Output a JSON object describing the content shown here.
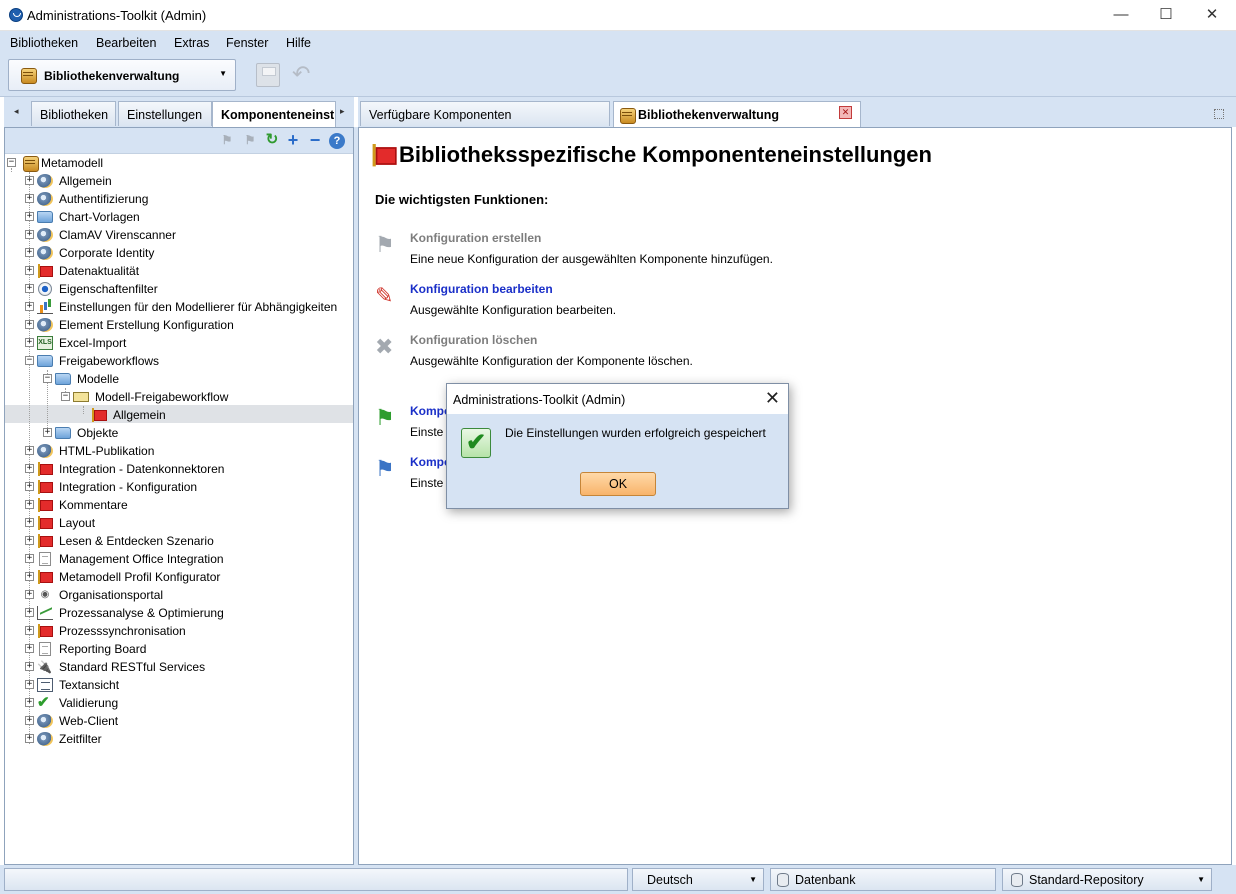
{
  "window": {
    "title": "Administrations-Toolkit (Admin)",
    "min": "—",
    "max": "☐",
    "close": "✕"
  },
  "menu": [
    "Bibliotheken",
    "Bearbeiten",
    "Extras",
    "Fenster",
    "Hilfe"
  ],
  "toolbar": {
    "library_select": "Bibliothekenverwaltung"
  },
  "left_tabs": [
    "Bibliotheken",
    "Einstellungen",
    "Komponenteneinst"
  ],
  "right_tabs": [
    "Verfügbare Komponenten",
    "Bibliothekenverwaltung"
  ],
  "tree": {
    "root": "Metamodell",
    "items": [
      "Allgemein",
      "Authentifizierung",
      "Chart-Vorlagen",
      "ClamAV Virenscanner",
      "Corporate Identity",
      "Datenaktualität",
      "Eigenschaftenfilter",
      "Einstellungen für den Modellierer für Abhängigkeiten",
      "Element Erstellung Konfiguration",
      "Excel-Import",
      "Freigabeworkflows"
    ],
    "freigabe_children": {
      "modelle": "Modelle",
      "modell_workflow": "Modell-Freigabeworkflow",
      "allgemein": "Allgemein",
      "objekte": "Objekte"
    },
    "items_after": [
      "HTML-Publikation",
      "Integration - Datenkonnektoren",
      "Integration - Konfiguration",
      "Kommentare",
      "Layout",
      "Lesen & Entdecken Szenario",
      "Management Office Integration",
      "Metamodell Profil Konfigurator",
      "Organisationsportal",
      "Prozessanalyse & Optimierung",
      "Prozesssynchronisation",
      "Reporting Board",
      "Standard RESTful Services",
      "Textansicht",
      "Validierung",
      "Web-Client",
      "Zeitfilter"
    ]
  },
  "content": {
    "title": "Bibliotheksspezifische Komponenteneinstellungen",
    "subtitle": "Die wichtigsten Funktionen:",
    "functions": [
      {
        "title": "Konfiguration erstellen",
        "desc": "Eine neue Konfiguration der ausgewählten Komponente hinzufügen."
      },
      {
        "title": "Konfiguration bearbeiten",
        "desc": "Ausgewählte Konfiguration bearbeiten."
      },
      {
        "title": "Konfiguration löschen",
        "desc": "Ausgewählte Konfiguration der Komponente löschen."
      },
      {
        "title": "Kompo",
        "desc": "Einste"
      },
      {
        "title": "Kompo",
        "desc": "Einste"
      }
    ]
  },
  "dialog": {
    "title": "Administrations-Toolkit (Admin)",
    "message": "Die Einstellungen wurden erfolgreich gespeichert",
    "ok": "OK"
  },
  "statusbar": {
    "language": "Deutsch",
    "datasource": "Datenbank",
    "repository": "Standard-Repository"
  },
  "colors": {
    "panel_bg": "#d6e3f3",
    "link": "#1a2fc8",
    "ok_button": "#f8b46b"
  }
}
